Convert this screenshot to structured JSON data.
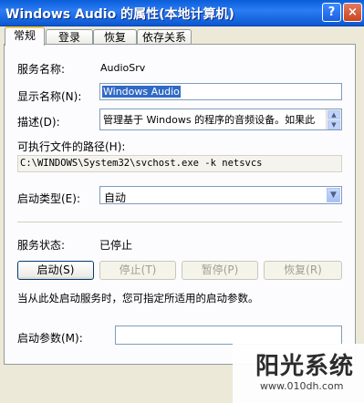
{
  "window": {
    "title": "Windows Audio 的属性(本地计算机)",
    "help_icon": "?",
    "close_icon": "×"
  },
  "tabs": [
    {
      "label": "常规",
      "active": true
    },
    {
      "label": "登录",
      "active": false
    },
    {
      "label": "恢复",
      "active": false
    },
    {
      "label": "依存关系",
      "active": false
    }
  ],
  "general": {
    "service_name_label": "服务名称:",
    "service_name_value": "AudioSrv",
    "display_name_label": "显示名称(N):",
    "display_name_value": "Windows Audio",
    "description_label": "描述(D):",
    "description_value": "管理基于 Windows 的程序的音频设备。如果此",
    "exe_path_label": "可执行文件的路径(H):",
    "exe_path_value": "C:\\WINDOWS\\System32\\svchost.exe -k netsvcs",
    "startup_type_label": "启动类型(E):",
    "startup_type_value": "自动",
    "service_status_label": "服务状态:",
    "service_status_value": "已停止",
    "start_button": "启动(S)",
    "stop_button": "停止(T)",
    "pause_button": "暂停(P)",
    "resume_button": "恢复(R)",
    "hint_text": "当从此处启动服务时，您可指定所适用的启动参数。",
    "start_params_label": "启动参数(M):",
    "start_params_value": ""
  },
  "watermark": {
    "brand": "阳光系统",
    "url": "www.010dh.com"
  }
}
